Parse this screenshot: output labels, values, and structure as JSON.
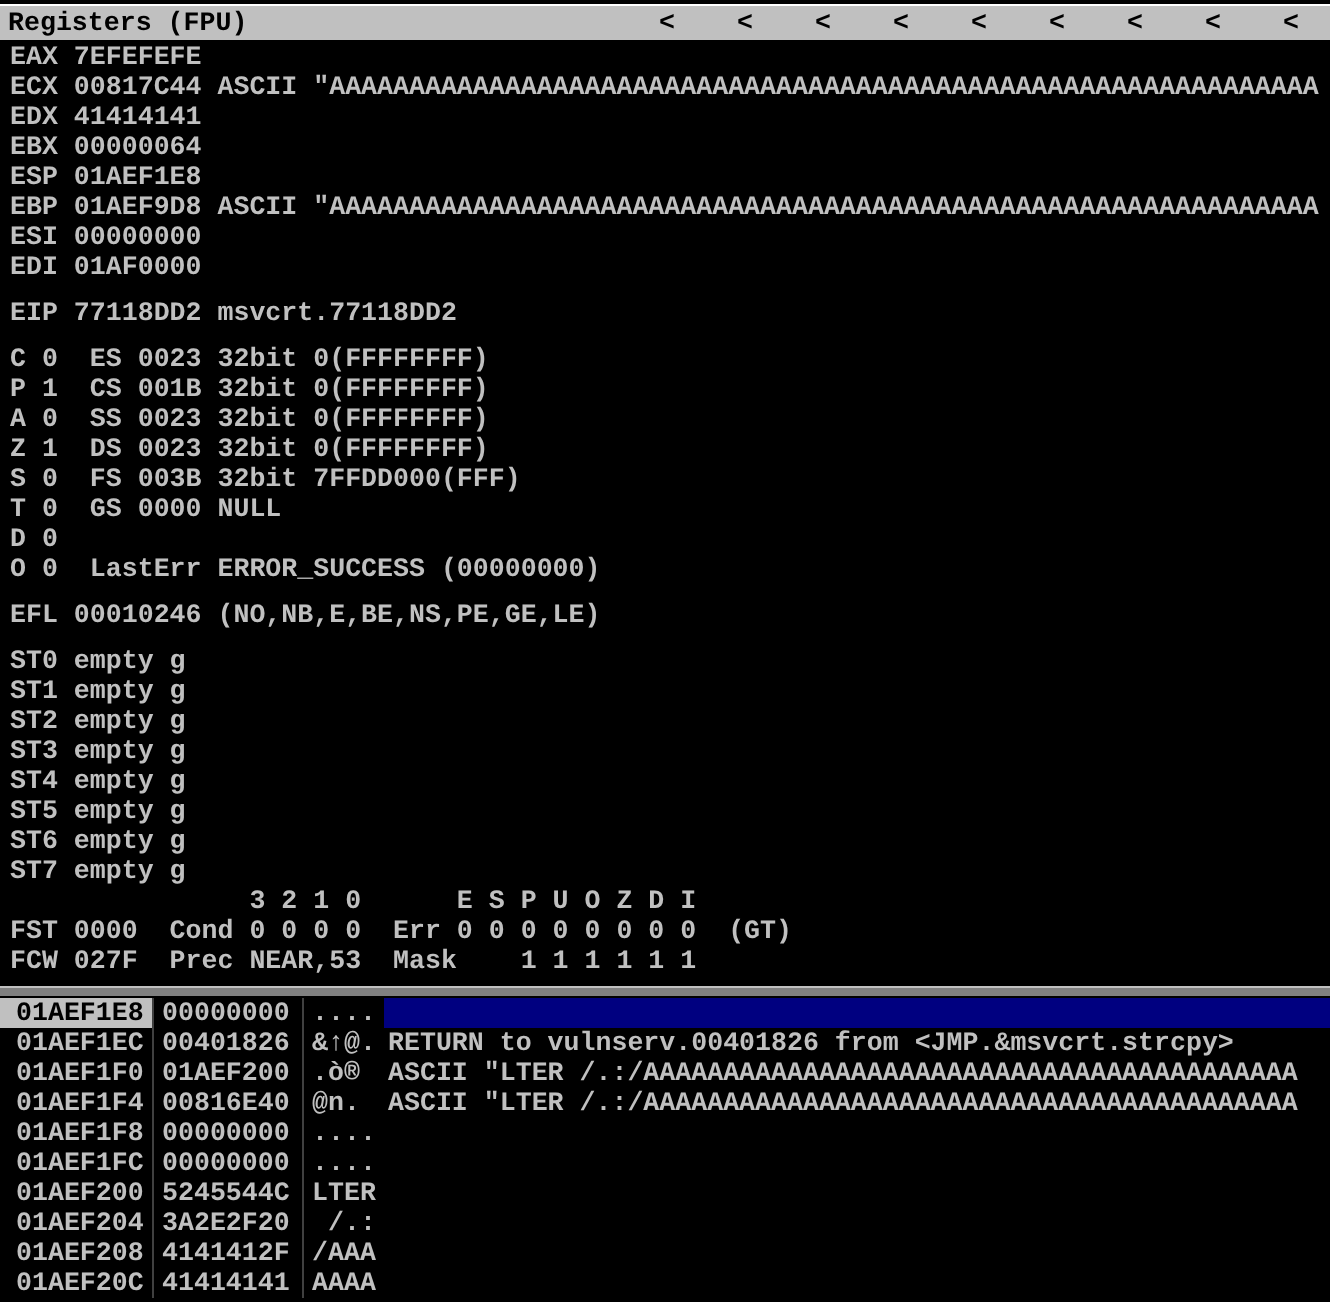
{
  "panel_title": "Registers (FPU)",
  "title_arrows": [
    "<",
    "<",
    "<",
    "<",
    "<",
    "<",
    "<",
    "<",
    "<"
  ],
  "register_groups": [
    [
      "EAX 7EFEFEFE",
      "ECX 00817C44 ASCII \"AAAAAAAAAAAAAAAAAAAAAAAAAAAAAAAAAAAAAAAAAAAAAAAAAAAAAAAAAAAAAA",
      "EDX 41414141",
      "EBX 00000064",
      "ESP 01AEF1E8",
      "EBP 01AEF9D8 ASCII \"AAAAAAAAAAAAAAAAAAAAAAAAAAAAAAAAAAAAAAAAAAAAAAAAAAAAAAAAAAAAAA",
      "ESI 00000000",
      "EDI 01AF0000"
    ],
    [
      "EIP 77118DD2 msvcrt.77118DD2"
    ],
    [
      "C 0  ES 0023 32bit 0(FFFFFFFF)",
      "P 1  CS 001B 32bit 0(FFFFFFFF)",
      "A 0  SS 0023 32bit 0(FFFFFFFF)",
      "Z 1  DS 0023 32bit 0(FFFFFFFF)",
      "S 0  FS 003B 32bit 7FFDD000(FFF)",
      "T 0  GS 0000 NULL",
      "D 0",
      "O 0  LastErr ERROR_SUCCESS (00000000)"
    ],
    [
      "EFL 00010246 (NO,NB,E,BE,NS,PE,GE,LE)"
    ],
    [
      "ST0 empty g",
      "ST1 empty g",
      "ST2 empty g",
      "ST3 empty g",
      "ST4 empty g",
      "ST5 empty g",
      "ST6 empty g",
      "ST7 empty g",
      "               3 2 1 0      E S P U O Z D I",
      "FST 0000  Cond 0 0 0 0  Err 0 0 0 0 0 0 0 0  (GT)",
      "FCW 027F  Prec NEAR,53  Mask    1 1 1 1 1 1"
    ]
  ],
  "stack_rows": [
    {
      "address": "01AEF1E8",
      "value": "00000000",
      "ascii": "....",
      "comment": "",
      "selected": true
    },
    {
      "address": "01AEF1EC",
      "value": "00401826",
      "ascii": "&↑@.",
      "comment": "RETURN to vulnserv.00401826 from <JMP.&msvcrt.strcpy>",
      "selected": false
    },
    {
      "address": "01AEF1F0",
      "value": "01AEF200",
      "ascii": ".ò®",
      "comment": "ASCII \"LTER /.:/AAAAAAAAAAAAAAAAAAAAAAAAAAAAAAAAAAAAAAAAA",
      "selected": false
    },
    {
      "address": "01AEF1F4",
      "value": "00816E40",
      "ascii": "@n.",
      "comment": "ASCII \"LTER /.:/AAAAAAAAAAAAAAAAAAAAAAAAAAAAAAAAAAAAAAAAA",
      "selected": false
    },
    {
      "address": "01AEF1F8",
      "value": "00000000",
      "ascii": "....",
      "comment": "",
      "selected": false
    },
    {
      "address": "01AEF1FC",
      "value": "00000000",
      "ascii": "....",
      "comment": "",
      "selected": false
    },
    {
      "address": "01AEF200",
      "value": "5245544C",
      "ascii": "LTER",
      "comment": "",
      "selected": false
    },
    {
      "address": "01AEF204",
      "value": "3A2E2F20",
      "ascii": " /.:",
      "comment": "",
      "selected": false
    },
    {
      "address": "01AEF208",
      "value": "4141412F",
      "ascii": "/AAA",
      "comment": "",
      "selected": false
    },
    {
      "address": "01AEF20C",
      "value": "41414141",
      "ascii": "AAAA",
      "comment": "",
      "selected": false
    }
  ]
}
